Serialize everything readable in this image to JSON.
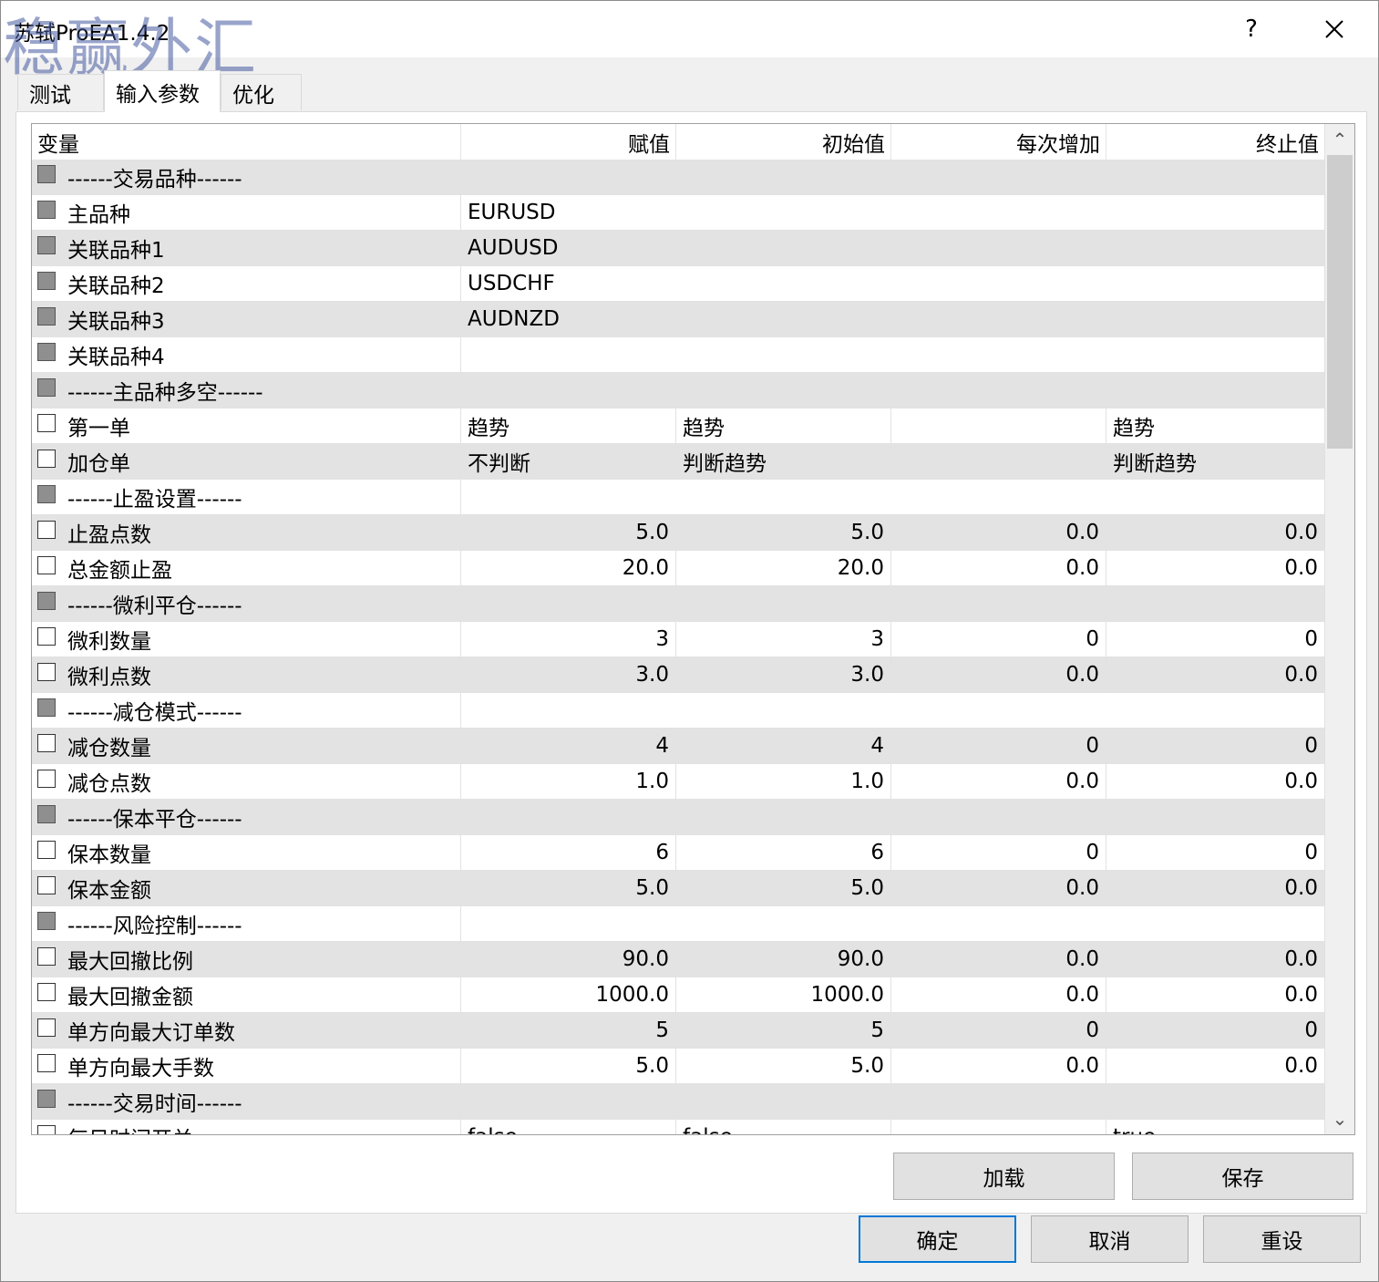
{
  "window": {
    "title": "苏轼ProEA1.4.2",
    "watermark": "稳赢外汇",
    "help_label": "?",
    "close_label": "✕"
  },
  "tabs": [
    {
      "label": "测试"
    },
    {
      "label": "输入参数"
    },
    {
      "label": "优化"
    }
  ],
  "grid": {
    "columns": [
      "变量",
      "赋值",
      "初始值",
      "每次增加",
      "终止值"
    ],
    "rows": [
      {
        "name": "------交易品种------",
        "section": true
      },
      {
        "name": "主品种",
        "value": "EURUSD",
        "text": true
      },
      {
        "name": "关联品种1",
        "value": "AUDUSD",
        "text": true
      },
      {
        "name": "关联品种2",
        "value": "USDCHF",
        "text": true
      },
      {
        "name": "关联品种3",
        "value": "AUDNZD",
        "text": true
      },
      {
        "name": "关联品种4",
        "value": "",
        "text": true
      },
      {
        "name": "------主品种多空------",
        "section": true
      },
      {
        "name": "第一单",
        "value": "趋势",
        "start": "趋势",
        "step": "",
        "stop": "趋势",
        "enum": true
      },
      {
        "name": "加仓单",
        "value": "不判断",
        "start": "判断趋势",
        "step": "",
        "stop": "判断趋势",
        "enum": true
      },
      {
        "name": "------止盈设置------",
        "section": true
      },
      {
        "name": "止盈点数",
        "value": "5.0",
        "start": "5.0",
        "step": "0.0",
        "stop": "0.0"
      },
      {
        "name": "总金额止盈",
        "value": "20.0",
        "start": "20.0",
        "step": "0.0",
        "stop": "0.0"
      },
      {
        "name": "------微利平仓------",
        "section": true
      },
      {
        "name": "微利数量",
        "value": "3",
        "start": "3",
        "step": "0",
        "stop": "0"
      },
      {
        "name": "微利点数",
        "value": "3.0",
        "start": "3.0",
        "step": "0.0",
        "stop": "0.0"
      },
      {
        "name": "------减仓模式------",
        "section": true
      },
      {
        "name": "减仓数量",
        "value": "4",
        "start": "4",
        "step": "0",
        "stop": "0"
      },
      {
        "name": "减仓点数",
        "value": "1.0",
        "start": "1.0",
        "step": "0.0",
        "stop": "0.0"
      },
      {
        "name": "------保本平仓------",
        "section": true
      },
      {
        "name": "保本数量",
        "value": "6",
        "start": "6",
        "step": "0",
        "stop": "0"
      },
      {
        "name": "保本金额",
        "value": "5.0",
        "start": "5.0",
        "step": "0.0",
        "stop": "0.0"
      },
      {
        "name": "------风险控制------",
        "section": true
      },
      {
        "name": "最大回撤比例",
        "value": "90.0",
        "start": "90.0",
        "step": "0.0",
        "stop": "0.0"
      },
      {
        "name": "最大回撤金额",
        "value": "1000.0",
        "start": "1000.0",
        "step": "0.0",
        "stop": "0.0"
      },
      {
        "name": "单方向最大订单数",
        "value": "5",
        "start": "5",
        "step": "0",
        "stop": "0"
      },
      {
        "name": "单方向最大手数",
        "value": "5.0",
        "start": "5.0",
        "step": "0.0",
        "stop": "0.0"
      },
      {
        "name": "------交易时间------",
        "section": true
      },
      {
        "name": "每日时间开关",
        "value": "false",
        "start": "false",
        "step": "",
        "stop": "true",
        "enum": true,
        "partial": true
      }
    ]
  },
  "buttons": {
    "load": "加载",
    "save": "保存",
    "ok": "确定",
    "cancel": "取消",
    "reset": "重设"
  },
  "scroll": {
    "up": "⌃",
    "down": "⌄"
  }
}
